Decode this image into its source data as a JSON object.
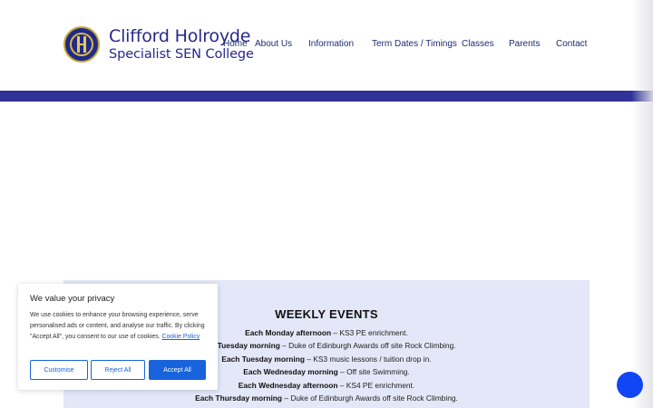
{
  "header": {
    "logo_line1": "Clifford Holroyde",
    "logo_line2": "Specialist SEN College",
    "nav": [
      "Home",
      "About Us",
      "Information",
      "Term Dates / Timings",
      "Classes",
      "Parents",
      "Contact"
    ]
  },
  "events": {
    "title": "WEEKLY EVENTS",
    "items": [
      {
        "when": "Each Monday afternoon",
        "what": " – KS3 PE enrichment."
      },
      {
        "when": "Each Tuesday morning",
        "what": " – Duke of Edinburgh Awards off site Rock Climbing."
      },
      {
        "when": "Each Tuesday morning",
        "what": " – KS3 music lessons / tuition drop in."
      },
      {
        "when": "Each Wednesday morning",
        "what": " – Off site Swimming."
      },
      {
        "when": "Each Wednesday afternoon",
        "what": " – KS4 PE enrichment."
      },
      {
        "when": "Each Thursday morning",
        "what": " – Duke of Edinburgh Awards off site Rock Climbing."
      }
    ]
  },
  "cookie_banner": {
    "title": "We value your privacy",
    "body": "We use cookies to enhance your browsing experience, serve personalised ads or content, and analyse our traffic. By clicking \"Accept All\", you consent to our use of cookies.",
    "policy_link": "Cookie Policy",
    "customise_label": "Customise",
    "reject_label": "Reject All",
    "accept_label": "Accept All"
  },
  "colors": {
    "brand_navy": "#30329a",
    "events_bg": "#e3e7f7",
    "cookie_accent": "#1863dc",
    "chat_button": "#1146f5"
  },
  "icons": {
    "logo": "college-crest-icon",
    "chat": "chat-launcher-icon"
  }
}
